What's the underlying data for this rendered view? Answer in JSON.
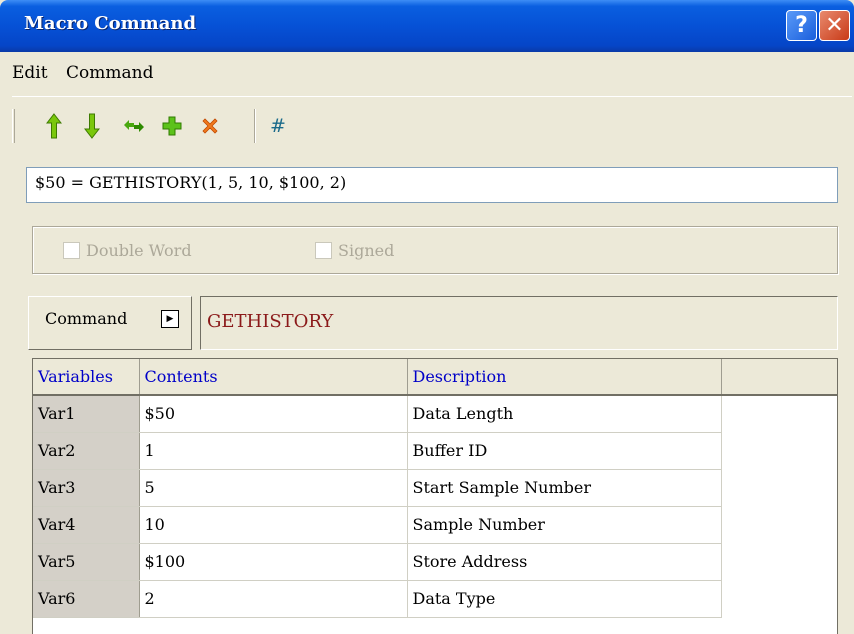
{
  "window": {
    "title": "Macro Command",
    "help_label": "?",
    "close_label": "✕"
  },
  "menu": {
    "edit": "Edit",
    "command": "Command"
  },
  "toolbar": {
    "icons": [
      "up-arrow-icon",
      "down-arrow-icon",
      "replace-icon",
      "add-icon",
      "delete-icon",
      "hash-icon"
    ],
    "hash_label": "#"
  },
  "expression": {
    "value": "$50 = GETHISTORY(1, 5, 10, $100, 2)"
  },
  "options": {
    "double_word": "Double Word",
    "signed": "Signed"
  },
  "command": {
    "button_label": "Command",
    "value": "GETHISTORY",
    "value_color": "#8b1a1a"
  },
  "grid": {
    "headers": [
      "Variables",
      "Contents",
      "Description"
    ],
    "rows": [
      [
        "Var1",
        "$50",
        "Data Length"
      ],
      [
        "Var2",
        "1",
        "Buffer ID"
      ],
      [
        "Var3",
        "5",
        "Start Sample Number"
      ],
      [
        "Var4",
        "10",
        "Sample Number"
      ],
      [
        "Var5",
        "$100",
        "Store Address"
      ],
      [
        "Var6",
        "2",
        "Data Type"
      ]
    ]
  },
  "colors": {
    "titlebar": "#0651d6",
    "header_text": "#0000c8",
    "window_bg": "#ece9d8"
  }
}
